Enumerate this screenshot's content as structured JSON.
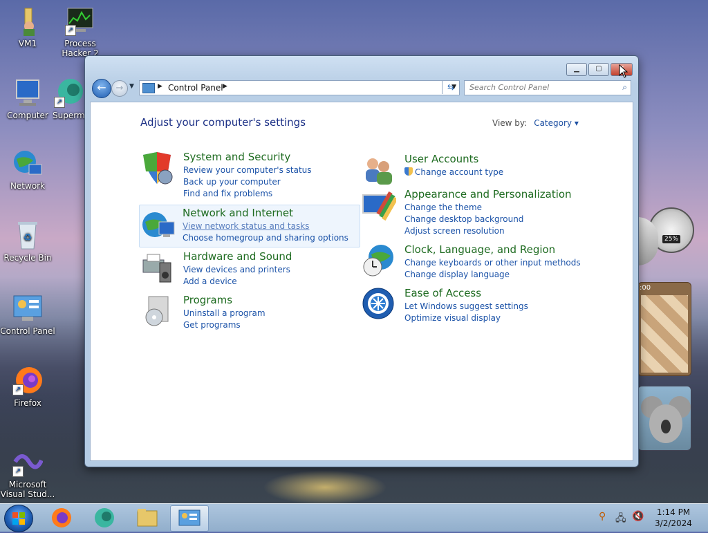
{
  "desktop": {
    "icons": [
      {
        "id": "vm1",
        "label": "VM1"
      },
      {
        "id": "process-hacker",
        "label": "Process Hacker 2"
      },
      {
        "id": "computer",
        "label": "Computer"
      },
      {
        "id": "superman",
        "label": "Superm..."
      },
      {
        "id": "network",
        "label": "Network"
      },
      {
        "id": "recycle-bin",
        "label": "Recycle Bin"
      },
      {
        "id": "control-panel",
        "label": "Control Panel"
      },
      {
        "id": "firefox",
        "label": "Firefox"
      },
      {
        "id": "visual-studio",
        "label": "Microsoft Visual Stud..."
      }
    ],
    "gadget_cpu_percent": "25%",
    "gadget_clock_time": ":00"
  },
  "window": {
    "address": {
      "crumb": "Control Panel"
    },
    "search": {
      "placeholder": "Search Control Panel"
    },
    "title": "Adjust your computer's settings",
    "view_by": {
      "label": "View by:",
      "value": "Category"
    },
    "categories": [
      {
        "title": "System and Security",
        "links": [
          "Review your computer's status",
          "Back up your computer",
          "Find and fix problems"
        ]
      },
      {
        "title": "Network and Internet",
        "links": [
          "View network status and tasks",
          "Choose homegroup and sharing options"
        ]
      },
      {
        "title": "Hardware and Sound",
        "links": [
          "View devices and printers",
          "Add a device"
        ]
      },
      {
        "title": "Programs",
        "links": [
          "Uninstall a program",
          "Get programs"
        ]
      },
      {
        "title": "User Accounts",
        "links": [
          "Change account type"
        ]
      },
      {
        "title": "Appearance and Personalization",
        "links": [
          "Change the theme",
          "Change desktop background",
          "Adjust screen resolution"
        ]
      },
      {
        "title": "Clock, Language, and Region",
        "links": [
          "Change keyboards or other input methods",
          "Change display language"
        ]
      },
      {
        "title": "Ease of Access",
        "links": [
          "Let Windows suggest settings",
          "Optimize visual display"
        ]
      }
    ]
  },
  "taskbar": {
    "clock": {
      "time": "1:14 PM",
      "date": "3/2/2024"
    }
  },
  "colors": {
    "link": "#1c53a8",
    "category_title": "#1e6b20",
    "title": "#1e3287"
  }
}
